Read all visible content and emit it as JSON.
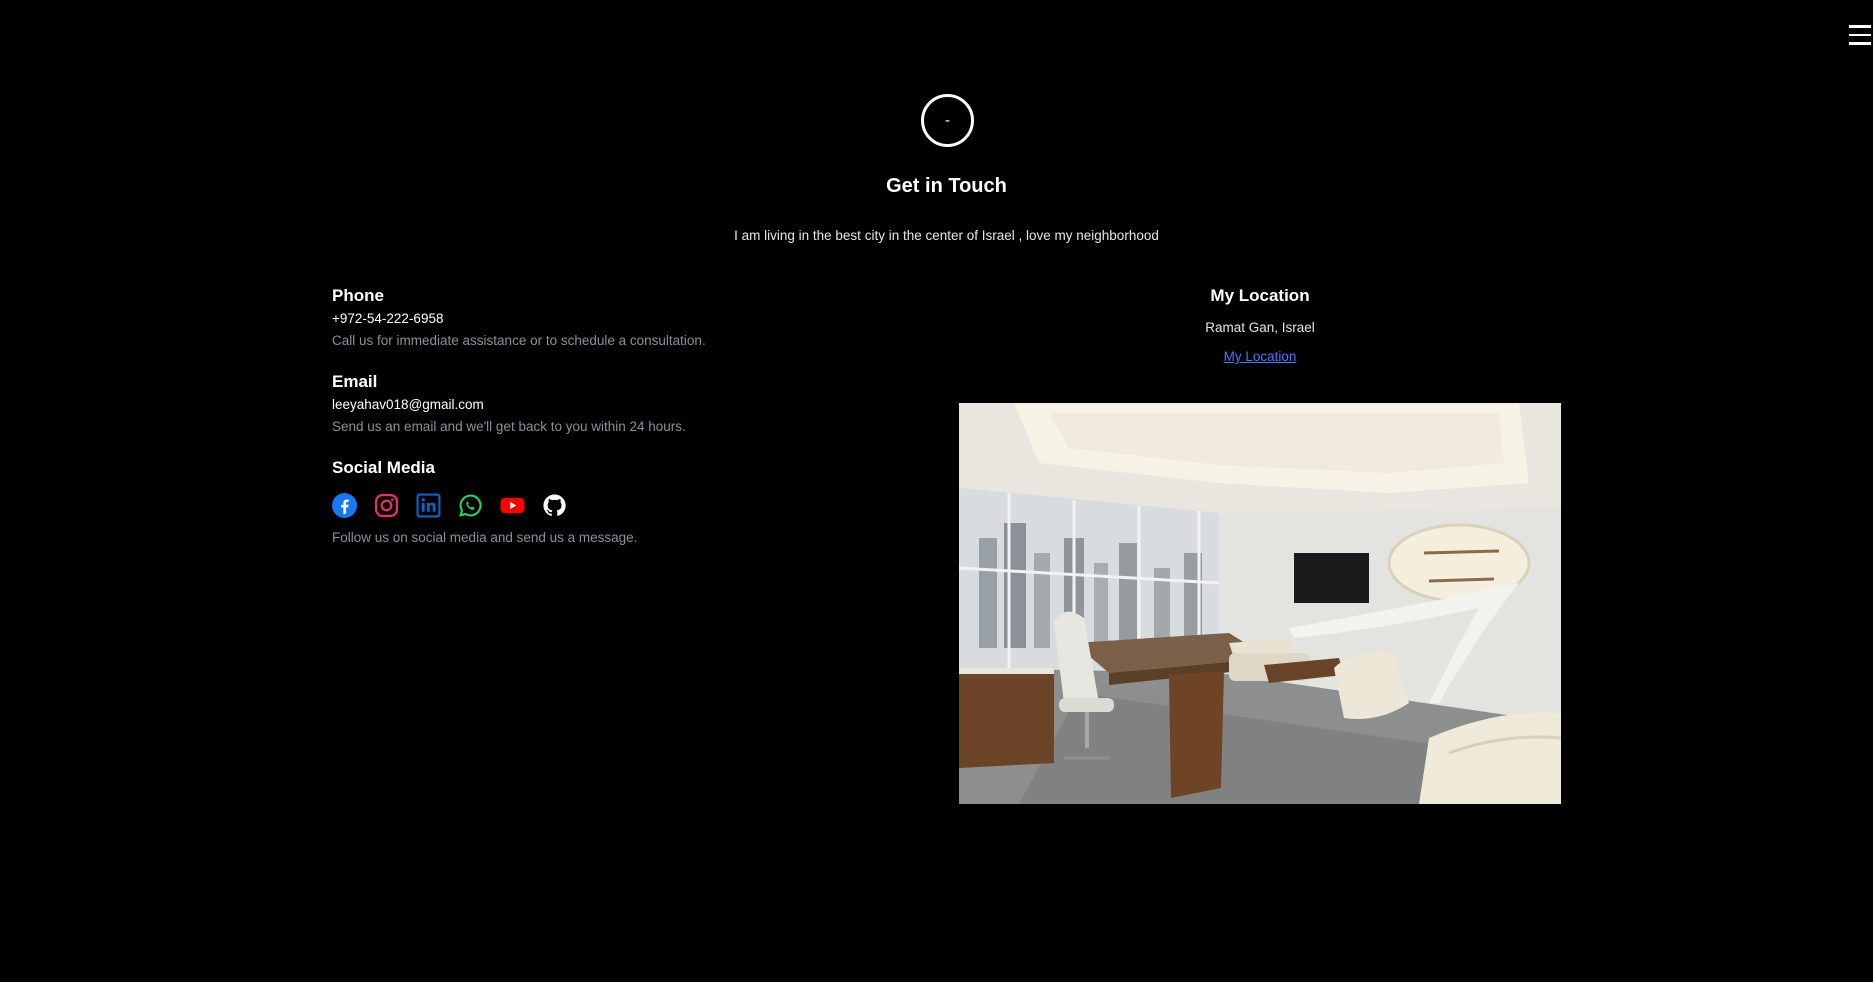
{
  "header": {
    "avatar_text": "-",
    "title": "Get in Touch",
    "intro": "I am living in the best city in the center of Israel , love my neighborhood"
  },
  "nav": {
    "menu_icon": "hamburger-menu-icon"
  },
  "contact": {
    "phone": {
      "title": "Phone",
      "value": "+972-54-222-6958",
      "desc": "Call us for immediate assistance or to schedule a consultation."
    },
    "email": {
      "title": "Email",
      "value": "leeyahav018@gmail.com",
      "desc": "Send us an email and we'll get back to you within 24 hours."
    },
    "social": {
      "title": "Social Media",
      "icons": [
        {
          "name": "facebook-icon",
          "color": "#1877f2"
        },
        {
          "name": "instagram-icon",
          "color": "#e1306c"
        },
        {
          "name": "linkedin-icon",
          "color": "#0a66c2"
        },
        {
          "name": "whatsapp-icon",
          "color": "#25d366"
        },
        {
          "name": "youtube-icon",
          "color": "#ff0000"
        },
        {
          "name": "github-icon",
          "color": "#ffffff"
        }
      ],
      "desc": "Follow us on social media and send us a message."
    }
  },
  "location": {
    "title": "My Location",
    "city": "Ramat Gan, Israel",
    "link_label": "My Location"
  },
  "colors": {
    "background": "#000000",
    "muted_text": "#8a8f99",
    "link": "#4a77ff"
  }
}
